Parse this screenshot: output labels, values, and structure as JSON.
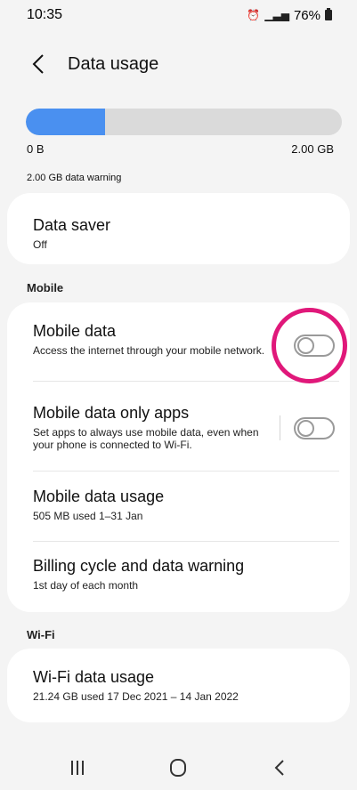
{
  "status": {
    "time": "10:35",
    "battery": "76%",
    "alarm_icon": "alarm-icon",
    "signal_icon": "signal-icon"
  },
  "header": {
    "title": "Data usage",
    "back_icon": "back-chevron-icon"
  },
  "usage": {
    "used_label": "0 B",
    "limit_label": "2.00 GB",
    "fill_fraction": 0.25,
    "warning_text": "2.00 GB data warning",
    "bar_color": "#4a90f0"
  },
  "data_saver": {
    "title": "Data saver",
    "status": "Off"
  },
  "sections": {
    "mobile": "Mobile",
    "wifi": "Wi-Fi"
  },
  "mobile": [
    {
      "title": "Mobile data",
      "subtitle": "Access the internet through your mobile network.",
      "toggle_on": false
    },
    {
      "title": "Mobile data only apps",
      "subtitle": "Set apps to always use mobile data, even when your phone is connected to Wi-Fi.",
      "toggle_on": false
    },
    {
      "title": "Mobile data usage",
      "subtitle": "505 MB used 1–31 Jan"
    },
    {
      "title": "Billing cycle and data warning",
      "subtitle": "1st day of each month"
    }
  ],
  "wifi_usage": {
    "title": "Wi-Fi data usage",
    "subtitle": "21.24 GB used 17 Dec 2021 – 14 Jan 2022"
  },
  "annotation_color": "#e0187a",
  "nav": {
    "recent_icon": "recent-apps-icon",
    "home_icon": "home-icon",
    "back_icon": "back-icon"
  }
}
